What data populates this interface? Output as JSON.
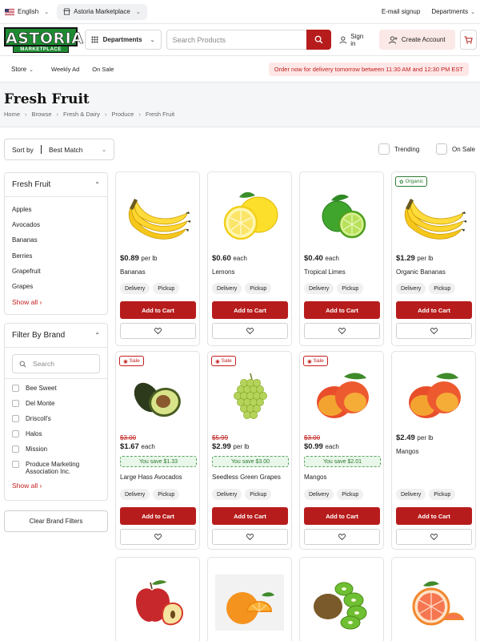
{
  "topbar": {
    "language": "English",
    "store_name": "Astoria Marketplace",
    "email_signup": "E-mail signup",
    "departments": "Departments"
  },
  "header": {
    "logo_line1": "ASTORIA",
    "logo_line2": "MARKETPLACE",
    "departments_label": "Departments",
    "search_placeholder": "Search Products",
    "sign_in": "Sign in",
    "create_account": "Create Account"
  },
  "nav": {
    "store": "Store",
    "weekly_ad": "Weekly Ad",
    "on_sale": "On Sale",
    "promo": "Order now for delivery tomorrow between 11:30 AM and 12:30 PM EST"
  },
  "page": {
    "title": "Fresh Fruit",
    "breadcrumbs": [
      "Home",
      "Browse",
      "Fresh & Dairy",
      "Produce",
      "Fresh Fruit"
    ]
  },
  "sort": {
    "label": "Sort by",
    "value": "Best Match",
    "trending": "Trending",
    "on_sale": "On Sale"
  },
  "sidebar": {
    "category_title": "Fresh Fruit",
    "categories": [
      "Apples",
      "Avocados",
      "Bananas",
      "Berries",
      "Grapefruit",
      "Grapes"
    ],
    "show_all": "Show all",
    "brand_title": "Filter By Brand",
    "brand_search_placeholder": "Search",
    "brands": [
      "Bee Sweet",
      "Del Monte",
      "Driscoll's",
      "Halos",
      "Mission",
      "Produce Marketing Association Inc."
    ],
    "brand_show_all": "Show all",
    "clear_filters": "Clear Brand Filters"
  },
  "colors": {
    "brand_red": "#b71c1c",
    "brand_green": "#1e8b32",
    "sale_red": "#c21d1d",
    "save_green": "#2e7d32"
  },
  "products": [
    {
      "name": "Bananas",
      "price": "$0.89",
      "unit": "per lb",
      "badge": "",
      "old_price": "",
      "save": "",
      "fulfillment": [
        "Delivery",
        "Pickup"
      ],
      "add_label": "Add to Cart",
      "image": "banana-image"
    },
    {
      "name": "Lemons",
      "price": "$0.60",
      "unit": "each",
      "badge": "",
      "old_price": "",
      "save": "",
      "fulfillment": [
        "Delivery",
        "Pickup"
      ],
      "add_label": "Add to Cart",
      "image": "lemon-image"
    },
    {
      "name": "Tropical Limes",
      "price": "$0.40",
      "unit": "each",
      "badge": "",
      "old_price": "",
      "save": "",
      "fulfillment": [
        "Delivery",
        "Pickup"
      ],
      "add_label": "Add to Cart",
      "image": "lime-image"
    },
    {
      "name": "Organic Bananas",
      "price": "$1.29",
      "unit": "per lb",
      "badge": "Organic",
      "old_price": "",
      "save": "",
      "fulfillment": [
        "Delivery",
        "Pickup"
      ],
      "add_label": "Add to Cart",
      "image": "banana-image"
    },
    {
      "name": "Large Hass Avocados",
      "price": "$1.67",
      "unit": "each",
      "badge": "Sale",
      "old_price": "$3.00",
      "save": "You save $1.33",
      "fulfillment": [
        "Delivery",
        "Pickup"
      ],
      "add_label": "Add to Cart",
      "image": "avocado-image"
    },
    {
      "name": "Seedless Green Grapes",
      "price": "$2.99",
      "unit": "per lb",
      "badge": "Sale",
      "old_price": "$5.99",
      "save": "You save $3.00",
      "fulfillment": [
        "Delivery",
        "Pickup"
      ],
      "add_label": "Add to Cart",
      "image": "grapes-image"
    },
    {
      "name": "Mangos",
      "price": "$0.99",
      "unit": "each",
      "badge": "Sale",
      "old_price": "$3.00",
      "save": "You save $2.01",
      "fulfillment": [
        "Delivery",
        "Pickup"
      ],
      "add_label": "Add to Cart",
      "image": "mango-image"
    },
    {
      "name": "Mangos",
      "price": "$2.49",
      "unit": "per lb",
      "badge": "",
      "old_price": "",
      "save": "",
      "fulfillment": [
        "Delivery",
        "Pickup"
      ],
      "add_label": "Add to Cart",
      "image": "mango-image"
    },
    {
      "name": "",
      "price": "",
      "unit": "",
      "badge": "",
      "old_price": "",
      "save": "",
      "fulfillment": [],
      "add_label": "",
      "image": "apple-image"
    },
    {
      "name": "",
      "price": "",
      "unit": "",
      "badge": "",
      "old_price": "",
      "save": "",
      "fulfillment": [],
      "add_label": "",
      "image": "orange-image"
    },
    {
      "name": "",
      "price": "",
      "unit": "",
      "badge": "",
      "old_price": "",
      "save": "",
      "fulfillment": [],
      "add_label": "",
      "image": "kiwi-image"
    },
    {
      "name": "",
      "price": "",
      "unit": "",
      "badge": "",
      "old_price": "",
      "save": "",
      "fulfillment": [],
      "add_label": "",
      "image": "grapefruit-image"
    }
  ]
}
